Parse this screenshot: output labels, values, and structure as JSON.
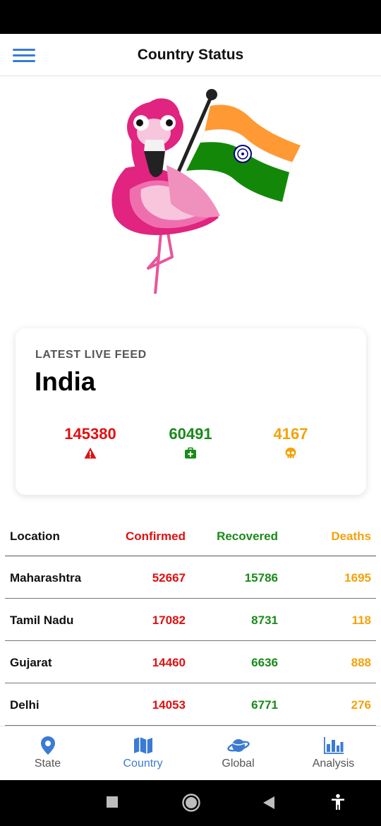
{
  "app_bar": {
    "title": "Country Status"
  },
  "summary": {
    "kicker": "LATEST LIVE FEED",
    "country": "India",
    "confirmed": "145380",
    "recovered": "60491",
    "deaths": "4167",
    "colors": {
      "confirmed": "#e01010",
      "recovered": "#1a8a1a",
      "deaths": "#f4a20c"
    }
  },
  "table": {
    "headers": {
      "location": "Location",
      "confirmed": "Confirmed",
      "recovered": "Recovered",
      "deaths": "Deaths"
    },
    "rows": [
      {
        "location": "Maharashtra",
        "confirmed": "52667",
        "recovered": "15786",
        "deaths": "1695"
      },
      {
        "location": "Tamil Nadu",
        "confirmed": "17082",
        "recovered": "8731",
        "deaths": "118"
      },
      {
        "location": "Gujarat",
        "confirmed": "14460",
        "recovered": "6636",
        "deaths": "888"
      },
      {
        "location": "Delhi",
        "confirmed": "14053",
        "recovered": "6771",
        "deaths": "276"
      }
    ]
  },
  "bottom_nav": {
    "items": [
      {
        "label": "State",
        "icon": "map-pin-icon"
      },
      {
        "label": "Country",
        "icon": "map-icon",
        "active": true
      },
      {
        "label": "Global",
        "icon": "planet-icon"
      },
      {
        "label": "Analysis",
        "icon": "bar-chart-icon"
      }
    ]
  },
  "icons": {
    "menu": "hamburger-menu-icon",
    "confirmed": "warning-icon",
    "recovered": "medical-kit-icon",
    "deaths": "skull-icon"
  }
}
